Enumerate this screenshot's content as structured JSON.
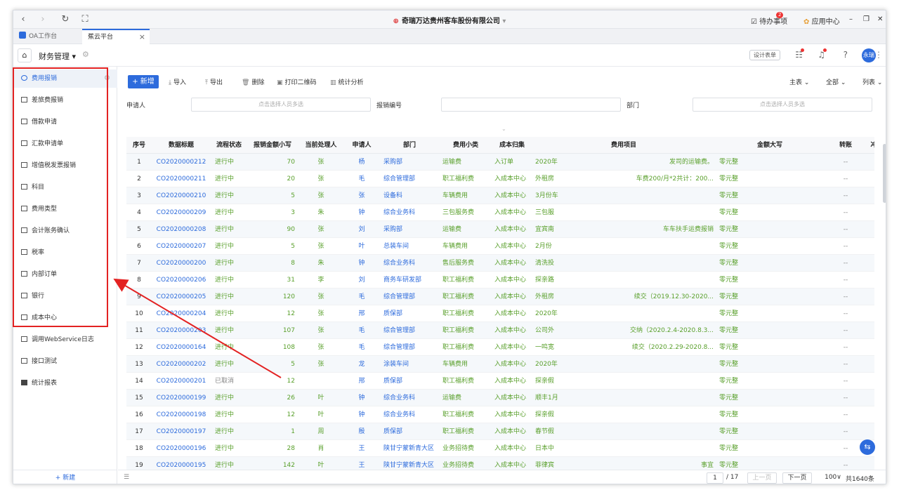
{
  "window": {
    "title": "奇瑞万达贵州客车股份有限公司",
    "todo_label": "待办事项",
    "todo_badge": "2",
    "app_center_label": "应用中心"
  },
  "tabs": [
    {
      "label": "OA工作台"
    },
    {
      "label": "蕉云平台",
      "close": "×"
    }
  ],
  "appbar": {
    "module_title": "财务管理 ▾",
    "design_btn": "设计表单",
    "avatar": "永瑞"
  },
  "sidebar": {
    "items": [
      {
        "label": "费用报销"
      },
      {
        "label": "差旅费报销"
      },
      {
        "label": "借款申请"
      },
      {
        "label": "汇款申请单"
      },
      {
        "label": "增值税发票报销"
      },
      {
        "label": "科目"
      },
      {
        "label": "费用类型"
      },
      {
        "label": "会计账务确认"
      },
      {
        "label": "税率"
      },
      {
        "label": "内部订单"
      },
      {
        "label": "银行"
      },
      {
        "label": "成本中心"
      },
      {
        "label": "调用WebService日志"
      },
      {
        "label": "接口测试"
      },
      {
        "label": "统计报表"
      }
    ],
    "new_label": "+ 新建"
  },
  "toolbar": {
    "new": "+ 新增",
    "import": "导入",
    "export": "导出",
    "delete": "删除",
    "print_qr": "打印二维码",
    "stats": "统计分析",
    "view_main": "主表",
    "view_all": "全部",
    "view_list": "列表"
  },
  "filters": {
    "applicant_label": "申请人",
    "applicant_placeholder": "点击选择人员多选",
    "number_label": "报销编号",
    "dept_label": "部门",
    "dept_placeholder": "点击选择人员多选"
  },
  "table": {
    "headers": [
      "序号",
      "数据标题",
      "流程状态",
      "报销金额小写",
      "当前处理人",
      "申请人",
      "部门",
      "费用小类",
      "成本归集",
      "费用项目",
      "金额大写",
      "转账",
      "冲"
    ],
    "rows": [
      {
        "no": "1",
        "title": "CO2020000212",
        "status": "进行中",
        "amount": "70",
        "handler": "张",
        "applicant": "杨",
        "dept": "采购部",
        "sub": "运输费",
        "cost": "入订单",
        "item": "2020年",
        "item2": "发司的运输费。",
        "upper": "零元整",
        "tr": "--"
      },
      {
        "no": "2",
        "title": "CO2020000211",
        "status": "进行中",
        "amount": "20",
        "handler": "张",
        "applicant": "毛",
        "dept": "综合管理部",
        "sub": "职工福利费",
        "cost": "入成本中心",
        "item": "外租房",
        "item2": "车费200/月*2共计：200...",
        "upper": "零元整",
        "tr": "--"
      },
      {
        "no": "3",
        "title": "CO2020000210",
        "status": "进行中",
        "amount": "5",
        "handler": "张",
        "applicant": "张",
        "dept": "设备科",
        "sub": "车辆费用",
        "cost": "入成本中心",
        "item": "3月份车",
        "item2": "",
        "upper": "零元整",
        "tr": "--"
      },
      {
        "no": "4",
        "title": "CO2020000209",
        "status": "进行中",
        "amount": "3",
        "handler": "朱",
        "applicant": "钟",
        "dept": "综合业务科",
        "sub": "三包服务费",
        "cost": "入成本中心",
        "item": "三包服",
        "item2": "",
        "upper": "零元整",
        "tr": "--"
      },
      {
        "no": "5",
        "title": "CO2020000208",
        "status": "进行中",
        "amount": "90",
        "handler": "张",
        "applicant": "刘",
        "dept": "采购部",
        "sub": "运输费",
        "cost": "入成本中心",
        "item": "宜宾南",
        "item2": "车车扶手运费报销",
        "upper": "零元整",
        "tr": "--"
      },
      {
        "no": "6",
        "title": "CO2020000207",
        "status": "进行中",
        "amount": "5",
        "handler": "张",
        "applicant": "叶",
        "dept": "总装车间",
        "sub": "车辆费用",
        "cost": "入成本中心",
        "item": "2月份",
        "item2": "",
        "upper": "零元整",
        "tr": "--"
      },
      {
        "no": "7",
        "title": "CO2020000200",
        "status": "进行中",
        "amount": "8",
        "handler": "朱",
        "applicant": "钟",
        "dept": "综合业务科",
        "sub": "售后服务费",
        "cost": "入成本中心",
        "item": "清洗投",
        "item2": "",
        "upper": "零元整",
        "tr": "--"
      },
      {
        "no": "8",
        "title": "CO2020000206",
        "status": "进行中",
        "amount": "31",
        "handler": "李",
        "applicant": "刘",
        "dept": "商务车研发部",
        "sub": "职工福利费",
        "cost": "入成本中心",
        "item": "探亲路",
        "item2": "",
        "upper": "零元整",
        "tr": "--"
      },
      {
        "no": "9",
        "title": "CO2020000205",
        "status": "进行中",
        "amount": "120",
        "handler": "张",
        "applicant": "毛",
        "dept": "综合管理部",
        "sub": "职工福利费",
        "cost": "入成本中心",
        "item": "外租房",
        "item2": "续交（2019.12.30-2020...",
        "upper": "零元整",
        "tr": "--"
      },
      {
        "no": "10",
        "title": "CO2020000204",
        "status": "进行中",
        "amount": "12",
        "handler": "张",
        "applicant": "邢",
        "dept": "质保部",
        "sub": "职工福利费",
        "cost": "入成本中心",
        "item": "2020年",
        "item2": "",
        "upper": "零元整",
        "tr": "--"
      },
      {
        "no": "11",
        "title": "CO2020000203",
        "status": "进行中",
        "amount": "107",
        "handler": "张",
        "applicant": "毛",
        "dept": "综合管理部",
        "sub": "职工福利费",
        "cost": "入成本中心",
        "item": "公司外",
        "item2": "交纳（2020.2.4-2020.8.3...",
        "upper": "零元整",
        "tr": "--"
      },
      {
        "no": "12",
        "title": "CO2020000164",
        "status": "进行中",
        "amount": "108",
        "handler": "张",
        "applicant": "毛",
        "dept": "综合管理部",
        "sub": "职工福利费",
        "cost": "入成本中心",
        "item": "一鸣宽",
        "item2": "续交（2020.2.29-2020.8...",
        "upper": "零元整",
        "tr": "--"
      },
      {
        "no": "13",
        "title": "CO2020000202",
        "status": "进行中",
        "amount": "5",
        "handler": "张",
        "applicant": "龙",
        "dept": "涂装车间",
        "sub": "车辆费用",
        "cost": "入成本中心",
        "item": "2020年",
        "item2": "",
        "upper": "零元整",
        "tr": "--"
      },
      {
        "no": "14",
        "title": "CO2020000201",
        "status": "已取消",
        "amount": "12",
        "handler": "",
        "applicant": "邢",
        "dept": "质保部",
        "sub": "职工福利费",
        "cost": "入成本中心",
        "item": "探亲假",
        "item2": "",
        "upper": "零元整",
        "tr": "--"
      },
      {
        "no": "15",
        "title": "CO2020000199",
        "status": "进行中",
        "amount": "26",
        "handler": "叶",
        "applicant": "钟",
        "dept": "综合业务科",
        "sub": "运输费",
        "cost": "入成本中心",
        "item": "顺丰1月",
        "item2": "",
        "upper": "零元整",
        "tr": "--"
      },
      {
        "no": "16",
        "title": "CO2020000198",
        "status": "进行中",
        "amount": "12",
        "handler": "叶",
        "applicant": "钟",
        "dept": "综合业务科",
        "sub": "职工福利费",
        "cost": "入成本中心",
        "item": "探亲假",
        "item2": "",
        "upper": "零元整",
        "tr": "--"
      },
      {
        "no": "17",
        "title": "CO2020000197",
        "status": "进行中",
        "amount": "1",
        "handler": "周",
        "applicant": "殷",
        "dept": "质保部",
        "sub": "职工福利费",
        "cost": "入成本中心",
        "item": "春节假",
        "item2": "",
        "upper": "零元整",
        "tr": "--"
      },
      {
        "no": "18",
        "title": "CO2020000196",
        "status": "进行中",
        "amount": "28",
        "handler": "肖",
        "applicant": "王",
        "dept": "陕甘宁蒙新青大区",
        "sub": "业务招待费",
        "cost": "入成本中心",
        "item": "日本中",
        "item2": "",
        "upper": "零元整",
        "tr": "--"
      },
      {
        "no": "19",
        "title": "CO2020000195",
        "status": "进行中",
        "amount": "142",
        "handler": "叶",
        "applicant": "王",
        "dept": "陕甘宁蒙新青大区",
        "sub": "业务招待费",
        "cost": "入成本中心",
        "item": "菲律宾",
        "item2": "事宜",
        "upper": "零元整",
        "tr": "--"
      }
    ]
  },
  "pagination": {
    "current": "1",
    "total_pages": "/ 17",
    "prev": "上一页",
    "next": "下一页",
    "page_size": "100∨",
    "total": "共1640条"
  },
  "colors": {
    "accent": "#2d6bdc",
    "status_green": "#5aa02c",
    "annotation_red": "#e32222"
  }
}
